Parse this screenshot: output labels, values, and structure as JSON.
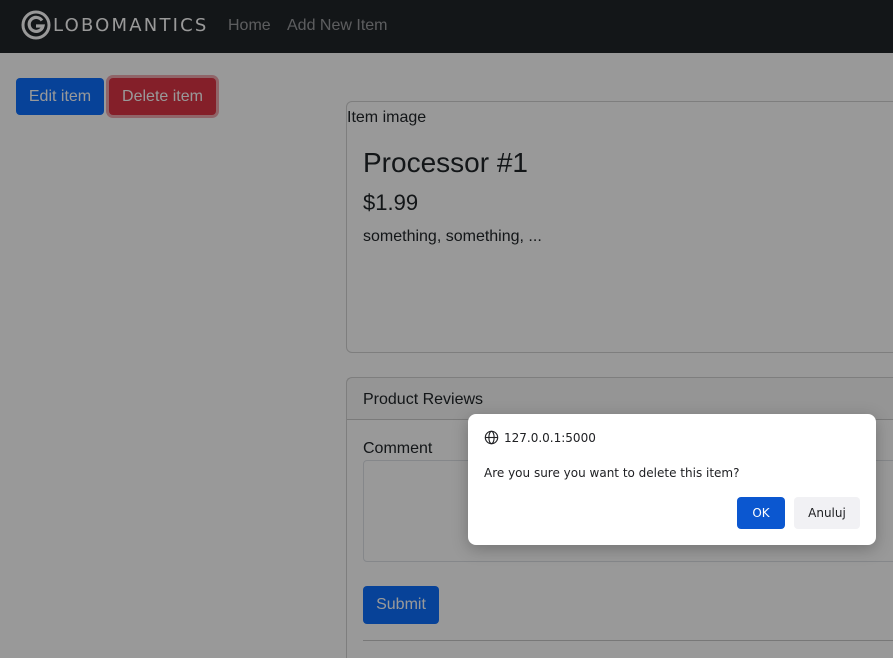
{
  "navbar": {
    "brand_text": "LOBOMANTICS",
    "links": [
      "Home",
      "Add New Item"
    ]
  },
  "actions": {
    "edit_label": "Edit item",
    "delete_label": "Delete item"
  },
  "item": {
    "image_alt": "Item image",
    "title": "Processor #1",
    "price": "$1.99",
    "description": "something, something, ..."
  },
  "reviews": {
    "header": "Product Reviews",
    "comment_label": "Comment",
    "comment_value": "",
    "submit_label": "Submit"
  },
  "dialog": {
    "origin": "127.0.0.1:5000",
    "message": "Are you sure you want to delete this item?",
    "ok_label": "OK",
    "cancel_label": "Anuluj"
  },
  "colors": {
    "navbar_bg": "#212529",
    "primary": "#0d6efd",
    "danger": "#dc3545",
    "dialog_ok": "#0b57d0"
  }
}
